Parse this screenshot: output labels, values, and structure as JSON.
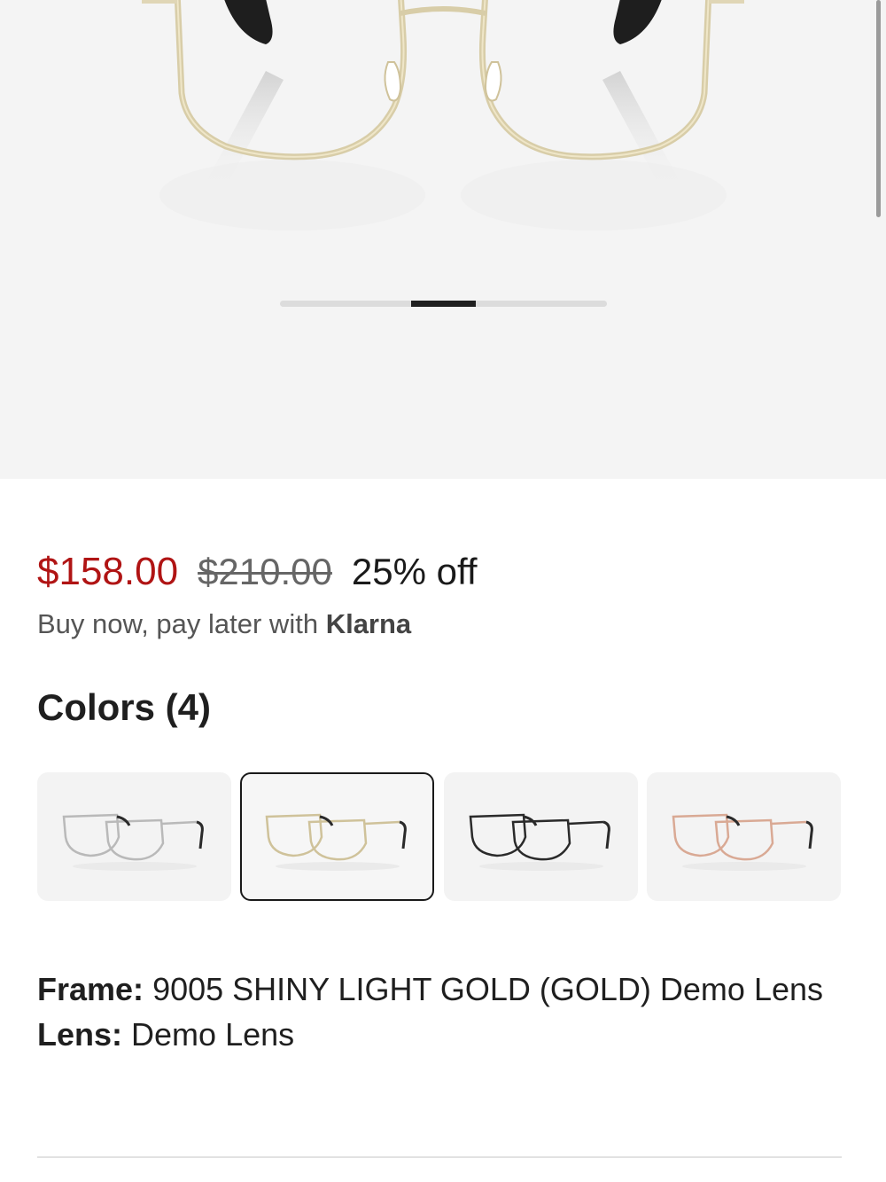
{
  "product": {
    "image_alt": "Gold metal eyeglasses front view",
    "carousel": {
      "slide_count": 5,
      "active_index": 2
    }
  },
  "pricing": {
    "sale_price": "$158.00",
    "original_price": "$210.00",
    "discount": "25% off",
    "sale_color": "#b01414"
  },
  "klarna": {
    "text": "Buy now, pay later with",
    "brand": "Klarna"
  },
  "colors": {
    "title": "Colors (4)",
    "swatches": [
      {
        "name": "silver",
        "frame_color": "#b9b9b9",
        "selected": false
      },
      {
        "name": "gold",
        "frame_color": "#cfc29a",
        "selected": true
      },
      {
        "name": "black",
        "frame_color": "#2a2a2a",
        "selected": false
      },
      {
        "name": "rose-gold",
        "frame_color": "#d9a994",
        "selected": false
      }
    ]
  },
  "details": {
    "frame_label": "Frame:",
    "frame_value": "9005 SHINY LIGHT GOLD (GOLD) Demo Lens",
    "lens_label": "Lens:",
    "lens_value": "Demo Lens"
  }
}
